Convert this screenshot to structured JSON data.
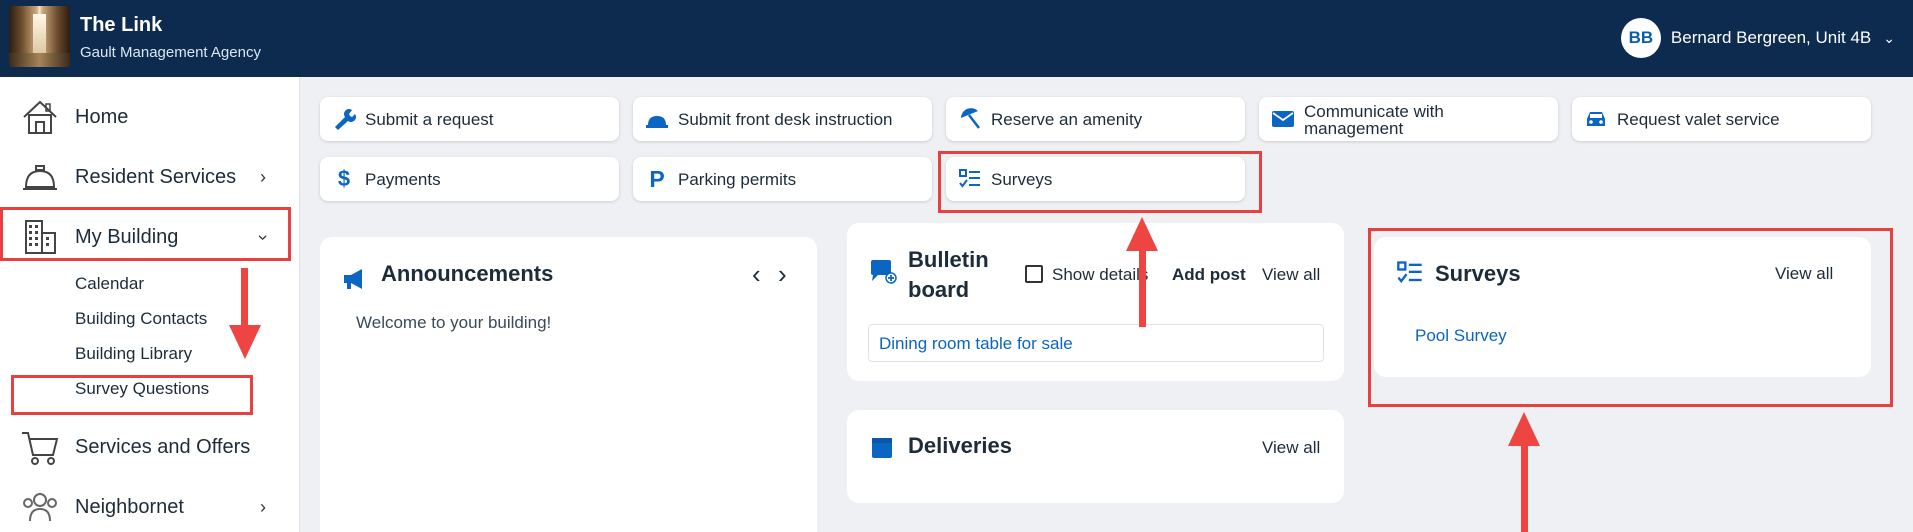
{
  "header": {
    "title": "The Link",
    "subtitle": "Gault Management Agency",
    "user_initials": "BB",
    "user_name": "Bernard Bergreen, Unit 4B"
  },
  "sidebar": {
    "home": "Home",
    "resident_services": "Resident Services",
    "my_building": "My Building",
    "sub_items": [
      "Calendar",
      "Building Contacts",
      "Building Library",
      "Survey Questions"
    ],
    "services_offers": "Services and Offers",
    "neighbornet": "Neighbornet"
  },
  "quick_actions": {
    "submit_request": "Submit a request",
    "front_desk": "Submit front desk instruction",
    "reserve_amenity": "Reserve an amenity",
    "communicate_1": "Communicate with",
    "communicate_2": "management",
    "valet": "Request valet service",
    "payments": "Payments",
    "parking": "Parking permits",
    "surveys": "Surveys"
  },
  "announcements": {
    "title": "Announcements",
    "message": "Welcome to your building!"
  },
  "bulletin": {
    "title_1": "Bulletin",
    "title_2": "board",
    "show_details": "Show details",
    "add_post": "Add post",
    "view_all": "View all",
    "post": "Dining room table for sale"
  },
  "deliveries": {
    "title": "Deliveries",
    "view_all": "View all"
  },
  "surveys_card": {
    "title": "Surveys",
    "view_all": "View all",
    "item": "Pool Survey"
  },
  "colors": {
    "header_bg": "#0c2b4e",
    "accent_blue": "#0b65c2",
    "annotation_red": "#e8403f"
  }
}
